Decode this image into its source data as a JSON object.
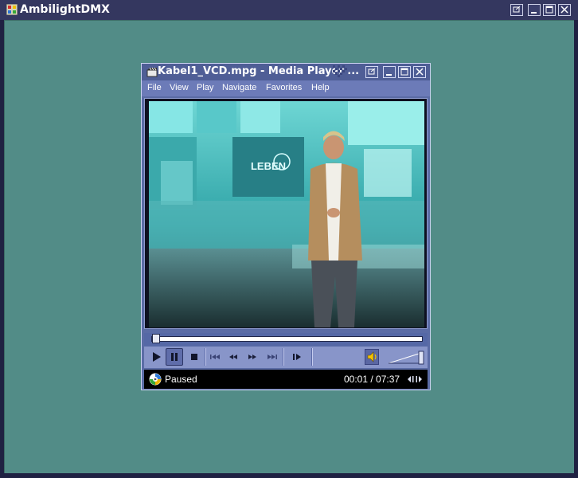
{
  "app": {
    "title": "AmbilightDMX",
    "icon": "app-window-icon"
  },
  "player": {
    "title": "Kabel1_VCD.mpg - Media Player ...",
    "menu": [
      "File",
      "View",
      "Play",
      "Navigate",
      "Favorites",
      "Help"
    ],
    "video_overlay_text": "LEBEN",
    "seek_position_fraction": 0.002,
    "volume_fraction": 1.0,
    "status": {
      "text": "Paused",
      "time": "00:01 / 07:37"
    },
    "controls": [
      "play",
      "pause",
      "stop",
      "previous",
      "rewind",
      "fast-forward",
      "next",
      "frame-step"
    ],
    "colors": {
      "titlebar": "#4f5e96",
      "menu": "#6c7bb8",
      "controls": "#8895c9",
      "client_background": "#528c87"
    }
  }
}
